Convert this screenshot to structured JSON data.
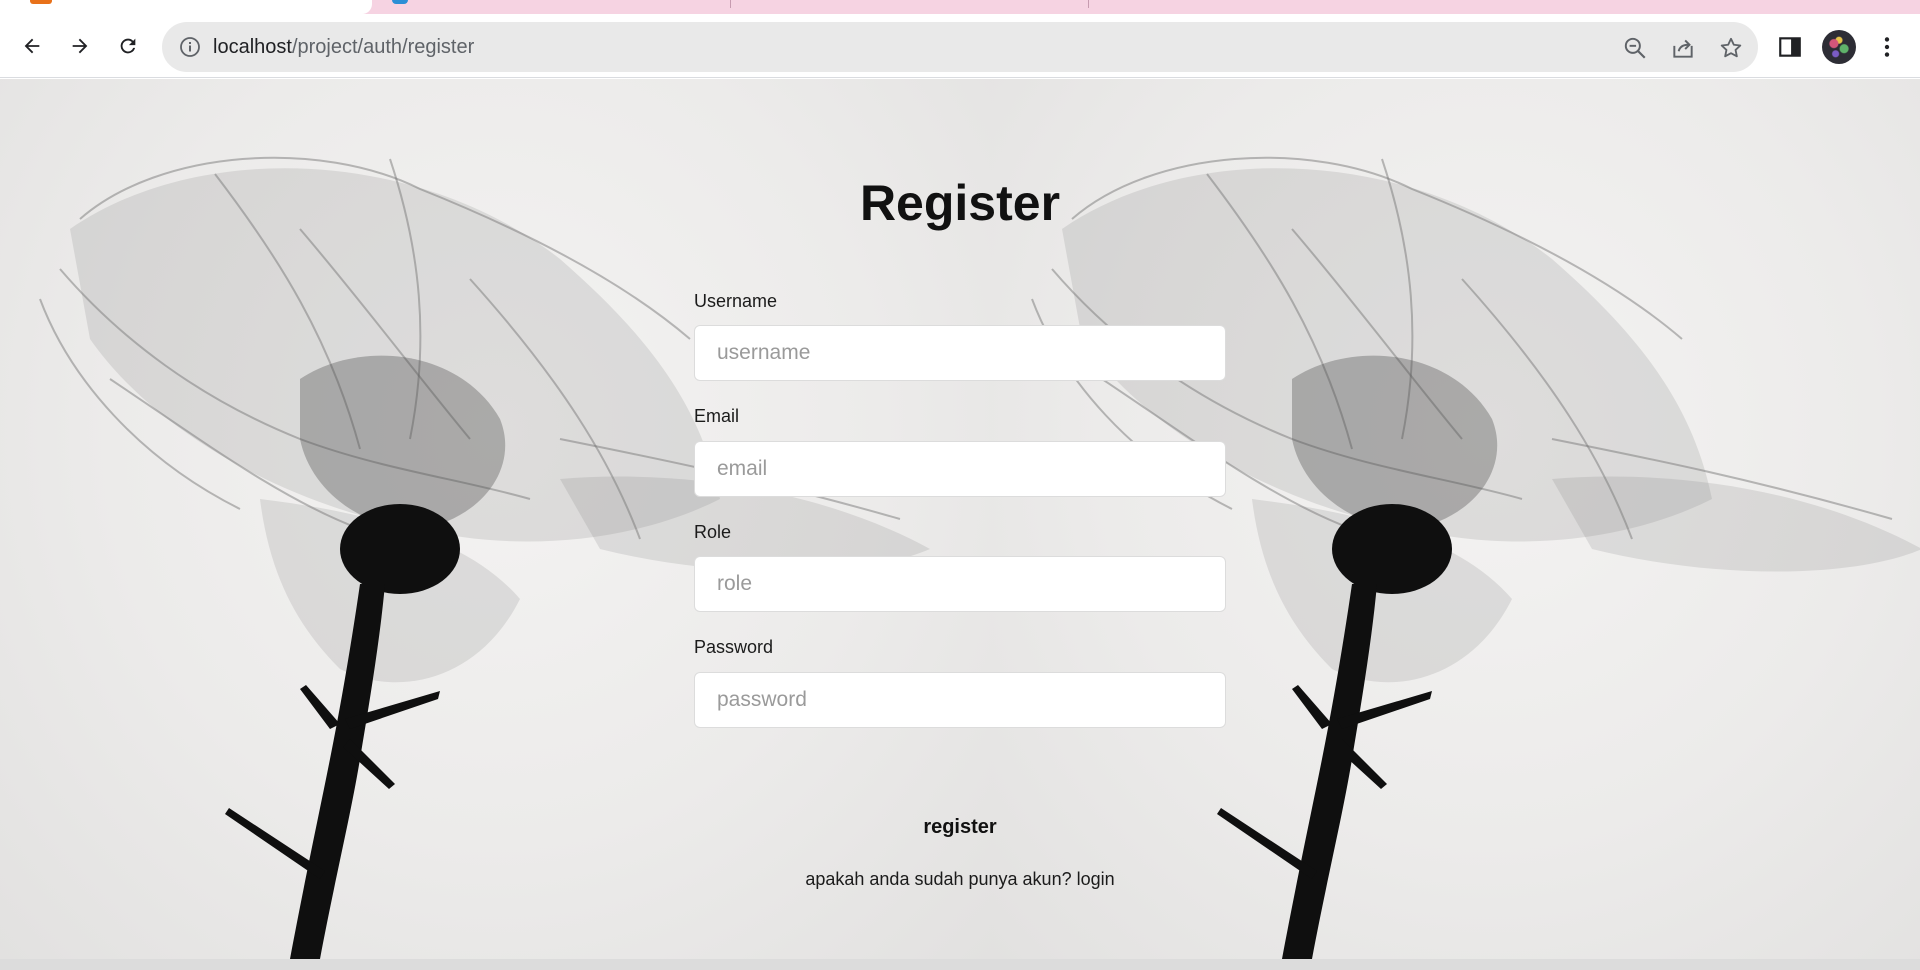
{
  "browser": {
    "url_host": "localhost",
    "url_path": "/project/auth/register"
  },
  "page": {
    "title": "Register",
    "fields": {
      "username": {
        "label": "Username",
        "placeholder": "username"
      },
      "email": {
        "label": "Email",
        "placeholder": "email"
      },
      "role": {
        "label": "Role",
        "placeholder": "role"
      },
      "password": {
        "label": "Password",
        "placeholder": "password"
      }
    },
    "register_label": "register",
    "login_prompt": "apakah anda sudah punya akun?",
    "login_link": "login"
  },
  "colors": {
    "tabstrip": "#f6d3e2",
    "omnibox": "#e9e9e9",
    "text": "#111111"
  }
}
